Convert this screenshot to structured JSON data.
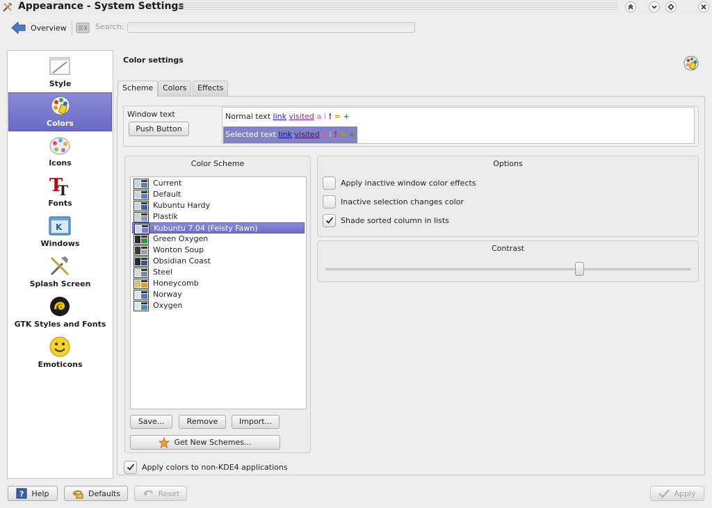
{
  "window": {
    "title": "Appearance - System Settings"
  },
  "toolbar": {
    "overview_label": "Overview",
    "search_label": "Search:",
    "search_value": ""
  },
  "sidebar": {
    "items": [
      {
        "label": "Style",
        "icon": "style-icon",
        "selected": false
      },
      {
        "label": "Colors",
        "icon": "colors-icon",
        "selected": true
      },
      {
        "label": "Icons",
        "icon": "icons-icon",
        "selected": false
      },
      {
        "label": "Fonts",
        "icon": "fonts-icon",
        "selected": false
      },
      {
        "label": "Windows",
        "icon": "windows-icon",
        "selected": false
      },
      {
        "label": "Splash Screen",
        "icon": "splash-screen-icon",
        "selected": false
      },
      {
        "label": "GTK Styles and Fonts",
        "icon": "gtk-icon",
        "selected": false
      },
      {
        "label": "Emoticons",
        "icon": "emoticons-icon",
        "selected": false
      }
    ]
  },
  "main": {
    "title": "Color settings",
    "tabs": [
      {
        "label": "Scheme",
        "active": true
      },
      {
        "label": "Colors",
        "active": false
      },
      {
        "label": "Effects",
        "active": false
      }
    ],
    "preview": {
      "window_text_label": "Window text",
      "push_button_label": "Push Button",
      "normal_text": "Normal text",
      "selected_text": "Selected text",
      "link": "link",
      "visited": "visited",
      "active_glyph": "a",
      "inactive_glyph": "i",
      "negative_glyph": "!",
      "neutral_glyph": "=",
      "positive_glyph": "+"
    },
    "color_scheme": {
      "title": "Color Scheme",
      "schemes": [
        {
          "name": "Current",
          "selected": false
        },
        {
          "name": "Default",
          "selected": false
        },
        {
          "name": "Kubuntu Hardy",
          "selected": false
        },
        {
          "name": "Plastik",
          "selected": false
        },
        {
          "name": "Kubuntu 7.04 (Feisty Fawn)",
          "selected": true
        },
        {
          "name": "Green Oxygen",
          "selected": false
        },
        {
          "name": "Wonton Soup",
          "selected": false
        },
        {
          "name": "Obsidian Coast",
          "selected": false
        },
        {
          "name": "Steel",
          "selected": false
        },
        {
          "name": "Honeycomb",
          "selected": false
        },
        {
          "name": "Norway",
          "selected": false
        },
        {
          "name": "Oxygen",
          "selected": false
        }
      ],
      "save_label": "Save...",
      "remove_label": "Remove",
      "import_label": "Import...",
      "get_new_label": "Get New Schemes..."
    },
    "options": {
      "title": "Options",
      "items": [
        {
          "label": "Apply inactive window color effects",
          "checked": false
        },
        {
          "label": "Inactive selection changes color",
          "checked": false
        },
        {
          "label": "Shade sorted column in lists",
          "checked": true
        }
      ]
    },
    "contrast": {
      "title": "Contrast",
      "value": 0.7
    },
    "apply_non_kde": {
      "label": "Apply colors to non-KDE4 applications",
      "checked": true
    }
  },
  "bottom": {
    "help_label": "Help",
    "defaults_label": "Defaults",
    "reset_label": "Reset",
    "apply_label": "Apply"
  },
  "colors": {
    "selection": "#7a7acf",
    "link": "#1b1bd0",
    "visited": "#7a2aa0"
  }
}
